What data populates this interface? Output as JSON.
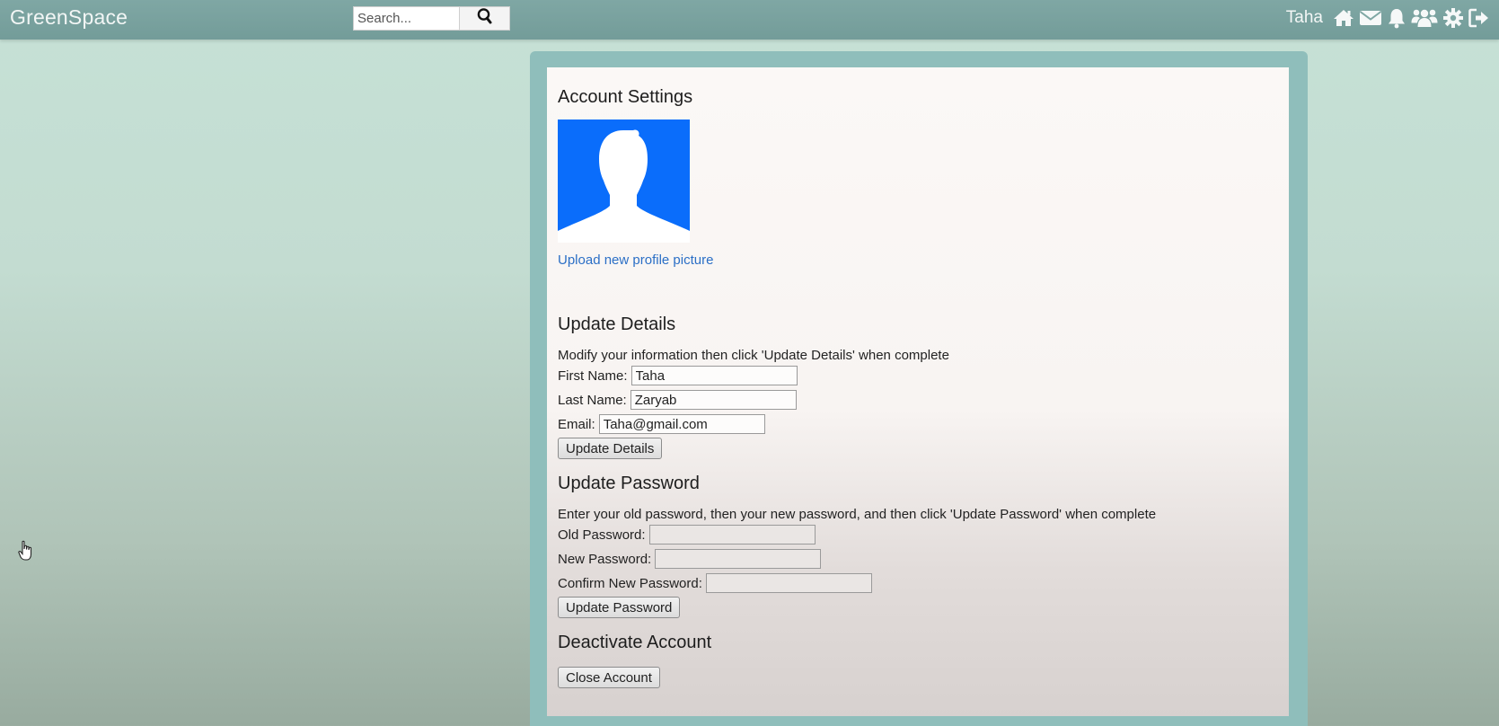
{
  "nav": {
    "brand": "GreenSpace",
    "search_placeholder": "Search...",
    "user_name": "Taha",
    "icons": [
      "home-icon",
      "mail-icon",
      "bell-icon",
      "friends-icon",
      "gear-icon",
      "logout-icon"
    ]
  },
  "account": {
    "title": "Account Settings",
    "upload_link": "Upload new profile picture"
  },
  "details": {
    "title": "Update Details",
    "description": "Modify your information then click 'Update Details' when complete",
    "first_name_label": "First Name:",
    "first_name_value": "Taha",
    "last_name_label": "Last Name:",
    "last_name_value": "Zaryab",
    "email_label": "Email:",
    "email_value": "Taha@gmail.com",
    "button": "Update Details"
  },
  "password": {
    "title": "Update Password",
    "description": "Enter your old password, then your new password, and then click 'Update Password' when complete",
    "old_label": "Old Password:",
    "new_label": "New Password:",
    "confirm_label": "Confirm New Password:",
    "button": "Update Password"
  },
  "deactivate": {
    "title": "Deactivate Account",
    "button": "Close Account"
  },
  "colors": {
    "navbar": "#7fa7a4",
    "avatar_bg": "#0a6dfb",
    "link": "#2b6fc6"
  }
}
